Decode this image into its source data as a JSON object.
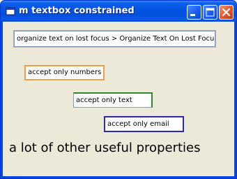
{
  "window": {
    "title": "m textbox constrained"
  },
  "textboxes": {
    "organize_on_lost_focus": "organize text on lost focus > Organize Text On Lost Focus",
    "numbers_only": "accept only numbers",
    "text_only": "accept only text",
    "email_only": "accept only email"
  },
  "label": {
    "text": "a lot of other useful properties"
  },
  "icons": {
    "app": "window-app-icon",
    "minimize": "minimize-icon",
    "maximize": "maximize-icon",
    "close": "close-icon"
  },
  "colors": {
    "titlebar": "#0553e3",
    "client_bg": "#ece9d8",
    "numbers_border": "#e8a04a",
    "text_border": "#2a8a2a",
    "email_border": "#2b2ba5",
    "close_button": "#e3542c"
  }
}
